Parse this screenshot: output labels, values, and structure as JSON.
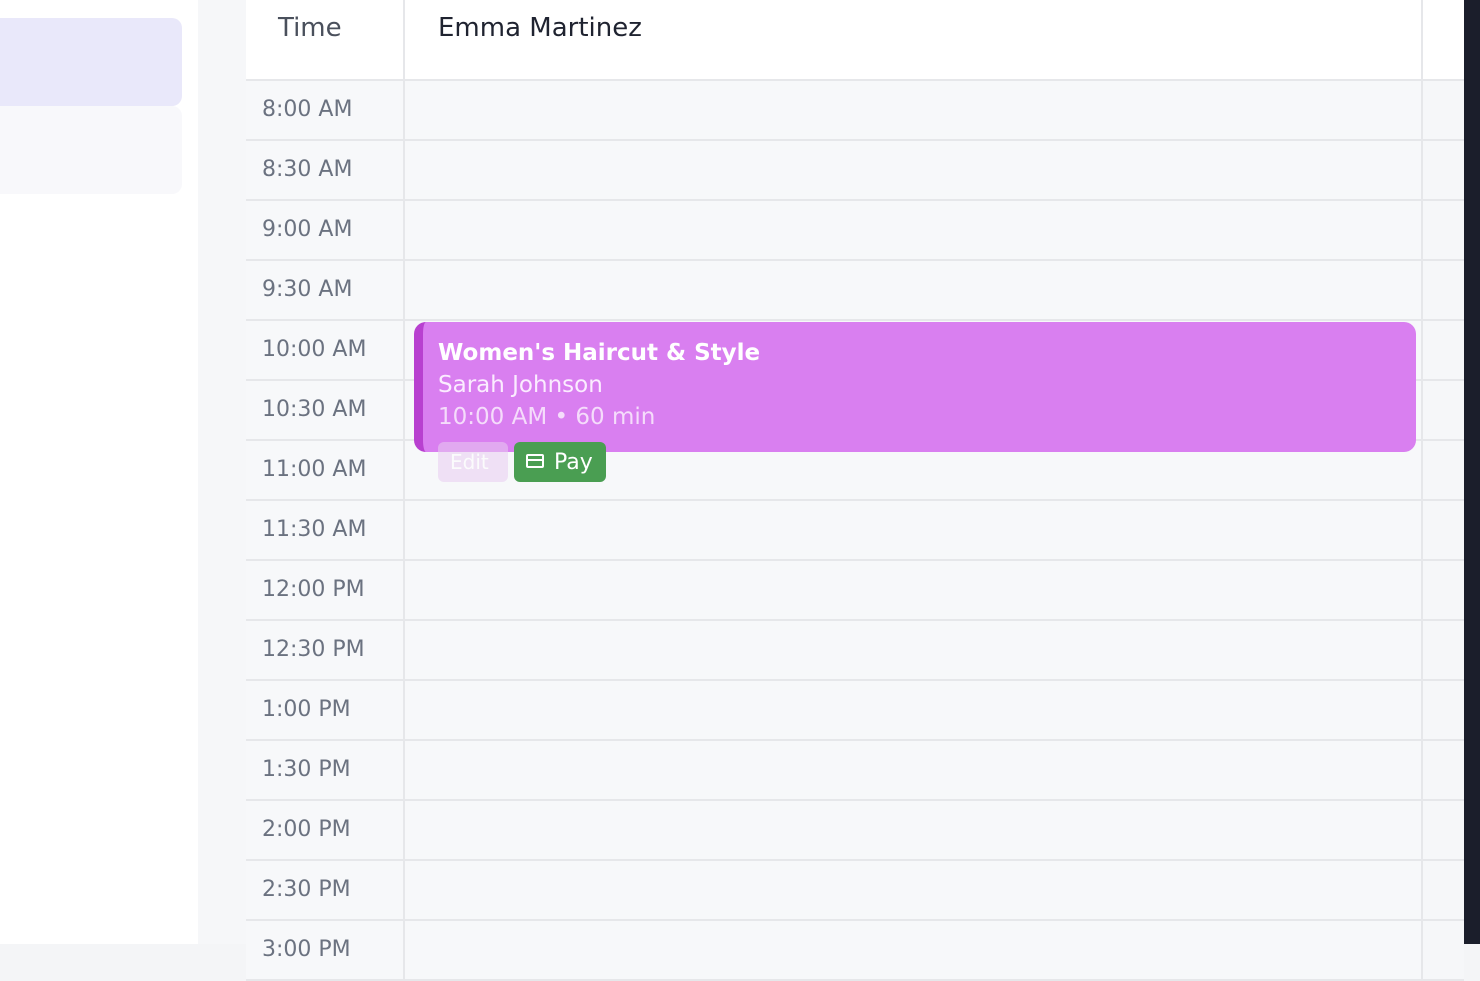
{
  "header": {
    "time_label": "Time",
    "staff_name": "Emma Martinez"
  },
  "time_slots": [
    "8:00 AM",
    "8:30 AM",
    "9:00 AM",
    "9:30 AM",
    "10:00 AM",
    "10:30 AM",
    "11:00 AM",
    "11:30 AM",
    "12:00 PM",
    "12:30 PM",
    "1:00 PM",
    "1:30 PM",
    "2:00 PM",
    "2:30 PM",
    "3:00 PM"
  ],
  "appointment": {
    "service": "Women's Haircut & Style",
    "client": "Sarah Johnson",
    "time_duration": "10:00 AM • 60 min",
    "color": "#d97ff0",
    "accent": "#b840d0"
  },
  "actions": {
    "edit_label": "Edit",
    "pay_label": "Pay",
    "pay_icon": "credit-card-icon",
    "pay_color": "#4a9e52"
  }
}
